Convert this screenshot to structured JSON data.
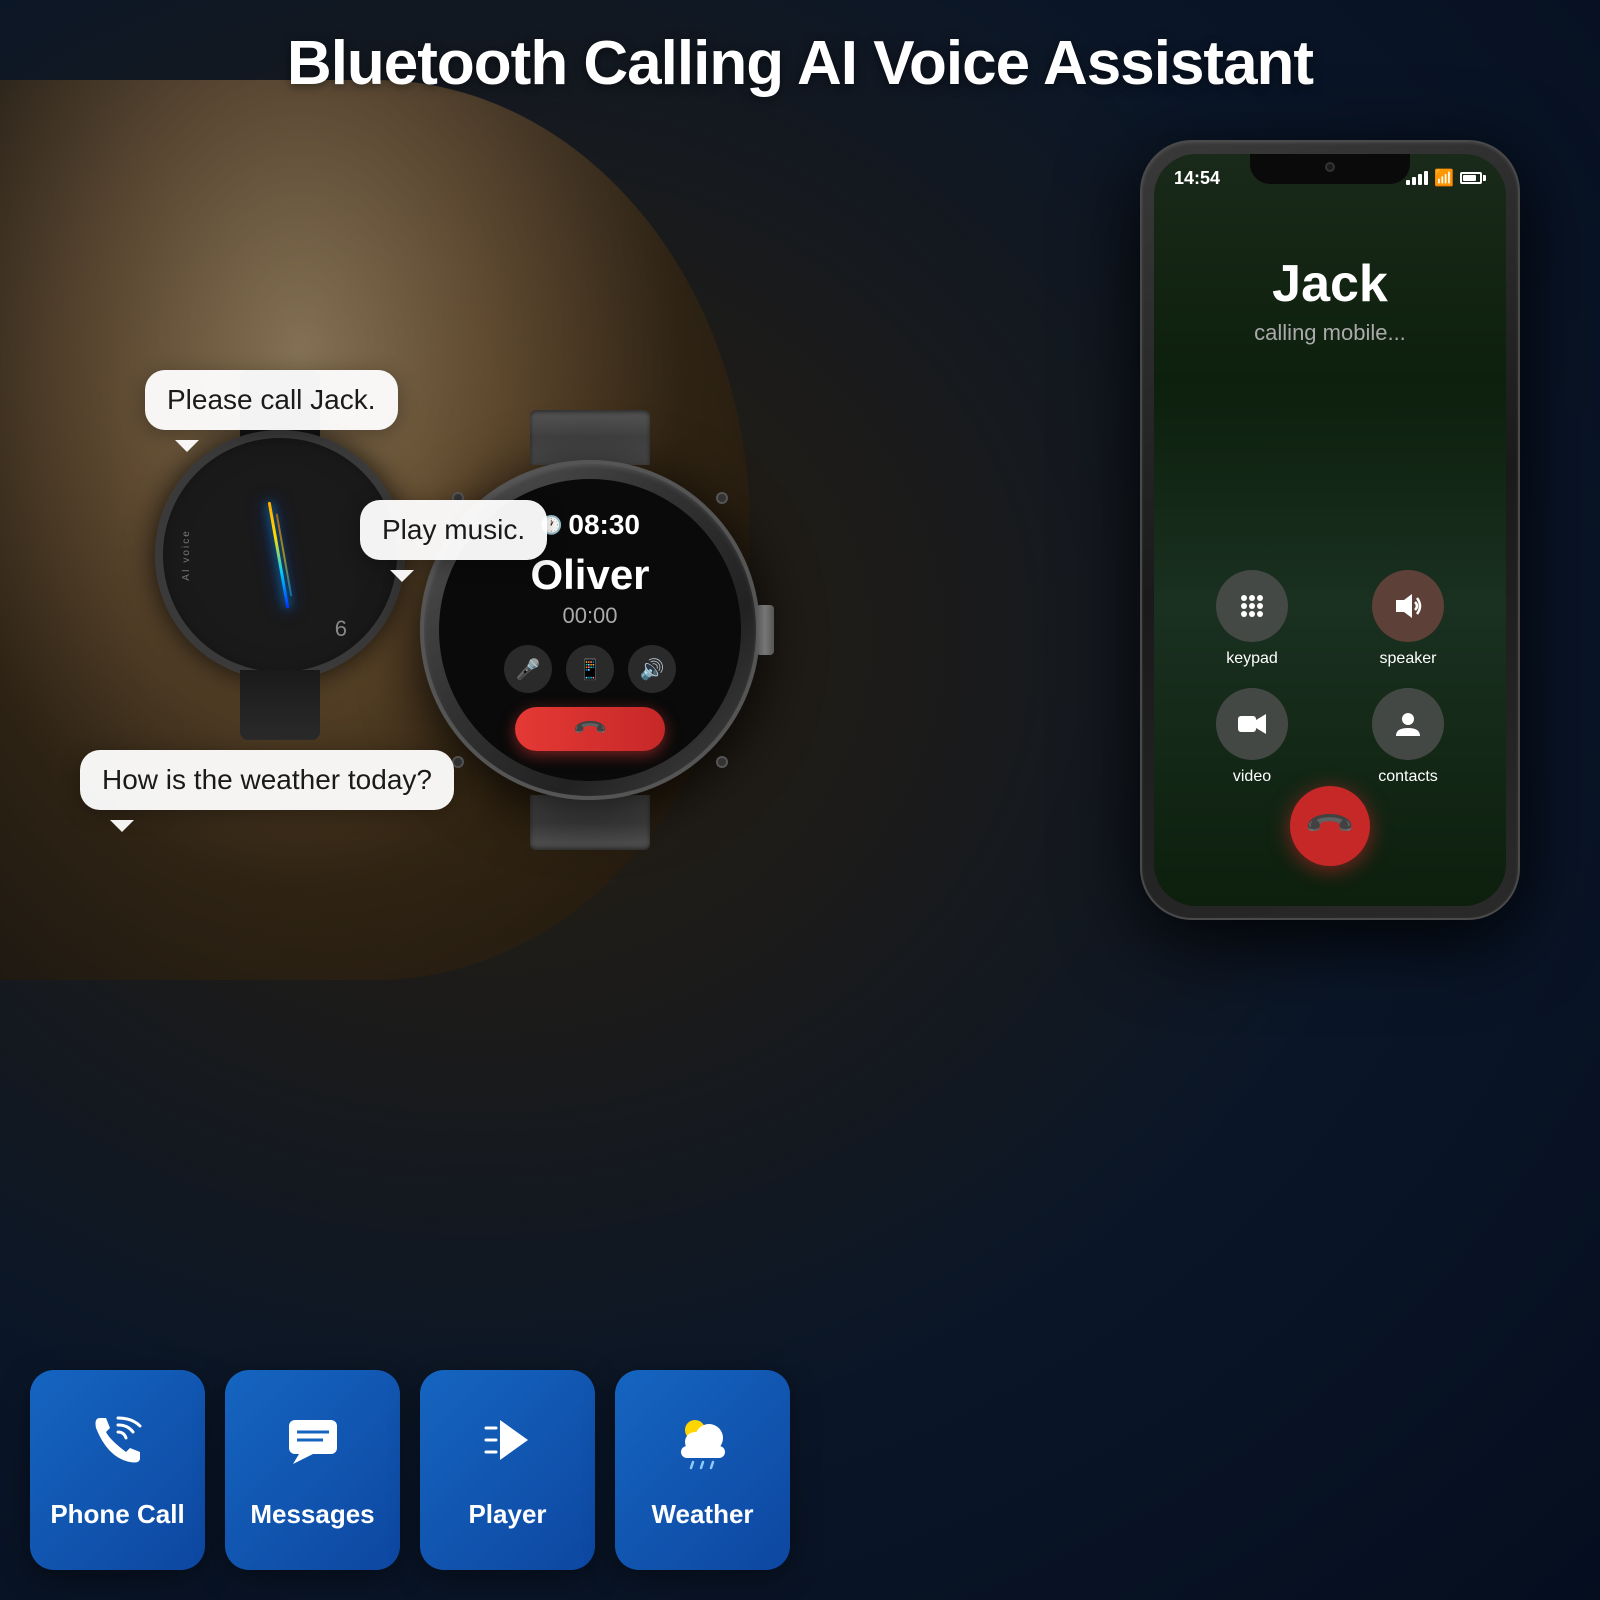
{
  "title": "Bluetooth Calling AI Voice Assistant",
  "bubbles": {
    "please_call": "Please call Jack.",
    "play_music": "Play music.",
    "how_weather": "How is the weather today?"
  },
  "watch_small": {
    "ai_label": "AI voice",
    "number": "6"
  },
  "watch_large": {
    "time": "08:30",
    "caller": "Oliver",
    "duration": "00:00",
    "controls": {
      "mic": "🎤",
      "phone": "📱",
      "speaker": "🔊"
    },
    "end_call": "📞"
  },
  "phone": {
    "status_bar": {
      "time": "14:54"
    },
    "caller_name": "Jack",
    "caller_status": "calling mobile...",
    "buttons": {
      "keypad": "keypad",
      "speaker": "speaker",
      "contacts": "contacts"
    }
  },
  "feature_tiles": [
    {
      "id": "phone-call",
      "label": "Phone Call",
      "icon": "📞"
    },
    {
      "id": "messages",
      "label": "Messages",
      "icon": "💬"
    },
    {
      "id": "player",
      "label": "Player",
      "icon": "🎵"
    },
    {
      "id": "weather",
      "label": "Weather",
      "icon": "⛅"
    }
  ]
}
